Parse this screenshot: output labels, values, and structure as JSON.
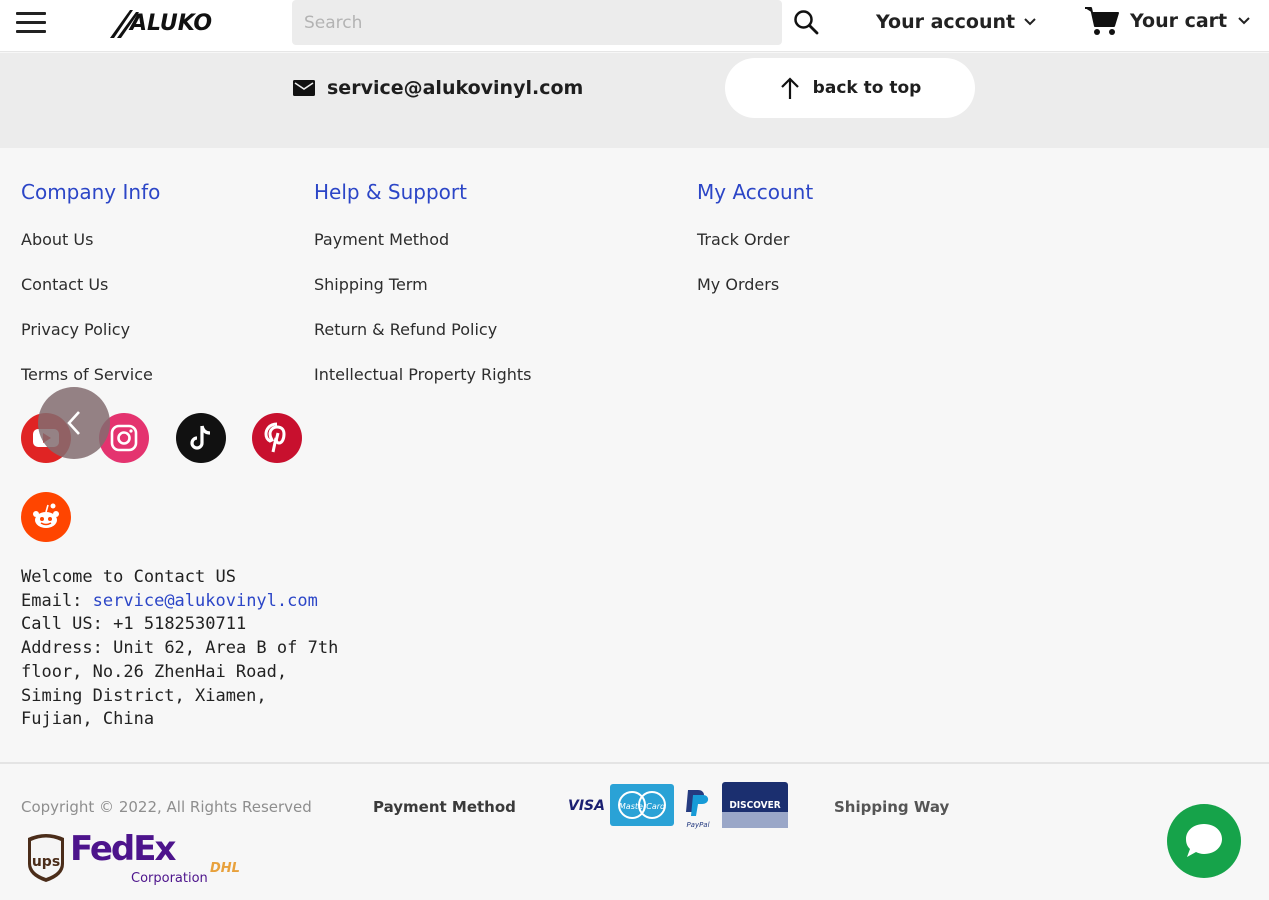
{
  "header": {
    "logo_text": "ALUKO",
    "search_placeholder": "Search",
    "account_label": "Your account",
    "cart_label": "Your cart"
  },
  "contact_strip": {
    "email": "service@alukovinyl.com",
    "back_to_top_label": "back to top"
  },
  "footer": {
    "columns": [
      {
        "title": "Company Info",
        "links": [
          "About Us",
          "Contact Us",
          "Privacy Policy",
          "Terms of Service"
        ]
      },
      {
        "title": "Help & Support",
        "links": [
          "Payment Method",
          "Shipping Term",
          "Return & Refund Policy",
          "Intellectual Property Rights"
        ]
      },
      {
        "title": "My Account",
        "links": [
          "Track Order",
          "My Orders"
        ]
      }
    ],
    "social_icons": [
      "youtube-icon",
      "instagram-icon",
      "tiktok-icon",
      "pinterest-icon",
      "reddit-icon"
    ],
    "contact": {
      "welcome": "Welcome to Contact US",
      "email_label": "Email:",
      "email": "service@alukovinyl.com",
      "call_label": "Call US:",
      "phone": "+1 5182530711",
      "address_label": "Address:",
      "address": "Unit 62, Area B of 7th floor, No.26 ZhenHai Road, Siming District, Xiamen, Fujian, China"
    }
  },
  "bottom": {
    "copyright": "Copyright © 2022, All Rights Reserved",
    "payment_label": "Payment Method",
    "payment_logos": [
      "VISA",
      "MasterCard",
      "PayPal",
      "DISCOVER"
    ],
    "shipping_label": "Shipping Way",
    "shipping_logos": [
      "ups",
      "FedEx",
      "Corporation",
      "DHL"
    ]
  },
  "colors": {
    "link_blue": "#2c46c7",
    "chat_green": "#16a34a",
    "instagram": "#e4336f",
    "pinterest": "#c8102e",
    "reddit": "#ff4500",
    "fedex_purple": "#4d148c",
    "fedex_orange": "#ff6600"
  }
}
